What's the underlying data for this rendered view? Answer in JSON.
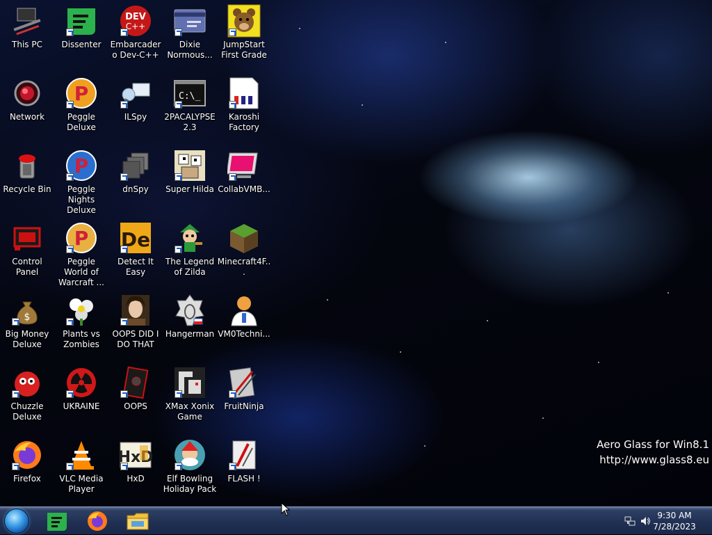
{
  "desktop": {
    "icons": [
      {
        "id": "this-pc",
        "label": "This PC",
        "icon": "this-pc-icon",
        "shortcut": false
      },
      {
        "id": "dissenter",
        "label": "Dissenter",
        "icon": "dissenter-icon",
        "shortcut": true
      },
      {
        "id": "embarcadero",
        "label": "Embarcadero Dev-C++",
        "icon": "devcpp-icon",
        "shortcut": true
      },
      {
        "id": "dixie",
        "label": "Dixie Normous...",
        "icon": "card-icon",
        "shortcut": true
      },
      {
        "id": "jumpstart",
        "label": "JumpStart First Grade",
        "icon": "bear-icon",
        "shortcut": true
      },
      {
        "id": "network",
        "label": "Network",
        "icon": "network-icon",
        "shortcut": false
      },
      {
        "id": "peggle-deluxe",
        "label": "Peggle Deluxe",
        "icon": "peggle-icon",
        "shortcut": true
      },
      {
        "id": "ilspy",
        "label": "ILSpy",
        "icon": "ilspy-icon",
        "shortcut": true
      },
      {
        "id": "2pacalypse",
        "label": "2PACALYPSE 2.3",
        "icon": "terminal-icon",
        "shortcut": true
      },
      {
        "id": "karoshi",
        "label": "Karoshi Factory",
        "icon": "karoshi-icon",
        "shortcut": true
      },
      {
        "id": "recycle-bin",
        "label": "Recycle Bin",
        "icon": "recycle-bin-icon",
        "shortcut": false
      },
      {
        "id": "peggle-nights",
        "label": "Peggle Nights Deluxe",
        "icon": "peggle-nights-icon",
        "shortcut": true
      },
      {
        "id": "dnspy",
        "label": "dnSpy",
        "icon": "dnspy-icon",
        "shortcut": true
      },
      {
        "id": "super-hilda",
        "label": "Super Hilda",
        "icon": "hilda-icon",
        "shortcut": true
      },
      {
        "id": "collabvmb",
        "label": "CollabVMB...",
        "icon": "monitor-icon",
        "shortcut": true
      },
      {
        "id": "control-panel",
        "label": "Control Panel",
        "icon": "control-panel-icon",
        "shortcut": false
      },
      {
        "id": "peggle-wow",
        "label": "Peggle World of Warcraft ...",
        "icon": "peggle-icon",
        "shortcut": true
      },
      {
        "id": "detect-it-easy",
        "label": "Detect It Easy",
        "icon": "die-icon",
        "shortcut": true
      },
      {
        "id": "zilda",
        "label": "The Legend of Zilda",
        "icon": "zilda-icon",
        "shortcut": true
      },
      {
        "id": "minecraft",
        "label": "Minecraft4F...",
        "icon": "grass-block-icon",
        "shortcut": false
      },
      {
        "id": "big-money",
        "label": "Big Money Deluxe",
        "icon": "money-bag-icon",
        "shortcut": true
      },
      {
        "id": "pvz",
        "label": "Plants vs Zombies",
        "icon": "flower-icon",
        "shortcut": true
      },
      {
        "id": "oops-did",
        "label": "OOPS DID I DO THAT",
        "icon": "portrait-icon",
        "shortcut": true
      },
      {
        "id": "hangerman",
        "label": "Hangerman",
        "icon": "hangerman-icon",
        "shortcut": true
      },
      {
        "id": "vm0techni",
        "label": "VM0Techni...",
        "icon": "person-icon",
        "shortcut": false
      },
      {
        "id": "chuzzle",
        "label": "Chuzzle Deluxe",
        "icon": "chuzzle-icon",
        "shortcut": true
      },
      {
        "id": "ukraine",
        "label": "UKRAINE",
        "icon": "radiation-icon",
        "shortcut": true
      },
      {
        "id": "oops",
        "label": "OOPS",
        "icon": "dark-doc-icon",
        "shortcut": true
      },
      {
        "id": "xmax",
        "label": "XMax Xonix Game",
        "icon": "xonix-icon",
        "shortcut": true
      },
      {
        "id": "fruitninja",
        "label": "FruitNinja",
        "icon": "fruitninja-icon",
        "shortcut": true
      },
      {
        "id": "firefox",
        "label": "Firefox",
        "icon": "firefox-icon",
        "shortcut": true
      },
      {
        "id": "vlc",
        "label": "VLC Media Player",
        "icon": "vlc-cone-icon",
        "shortcut": true
      },
      {
        "id": "hxd",
        "label": "HxD",
        "icon": "hxd-icon",
        "shortcut": true
      },
      {
        "id": "elf-bowling",
        "label": "Elf Bowling Holiday Pack",
        "icon": "elf-icon",
        "shortcut": true
      },
      {
        "id": "flash",
        "label": "FLASH !",
        "icon": "flash-icon",
        "shortcut": true
      }
    ]
  },
  "watermark": {
    "line1": "Aero Glass for Win8.1",
    "line2": "http://www.glass8.eu"
  },
  "taskbar": {
    "start_icon": "start-orb-icon",
    "pinned": [
      {
        "id": "dissenter",
        "icon": "dissenter-icon"
      },
      {
        "id": "firefox",
        "icon": "firefox-icon"
      },
      {
        "id": "file-explorer",
        "icon": "folder-icon"
      }
    ],
    "tray": {
      "network_icon": "network-tray-icon",
      "volume_icon": "speaker-icon"
    },
    "clock": {
      "time": "9:30 AM",
      "date": "7/28/2023"
    }
  },
  "colors": {
    "taskbar": "#1f2f52",
    "accent": "#3d9fe8",
    "dissenter_green": "#2bb24c",
    "firefox_orange": "#ff7a1a",
    "shortcut_red": "#c4000a"
  }
}
